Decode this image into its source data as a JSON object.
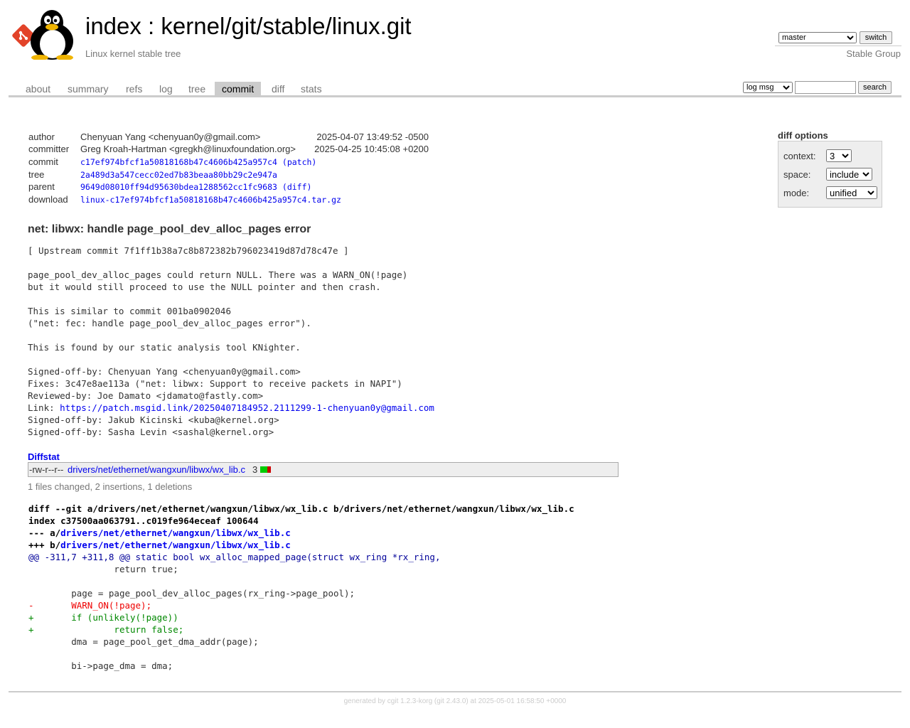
{
  "header": {
    "title_index": "index",
    "title_sep": " : ",
    "title_repo": "kernel/git/stable/linux.git",
    "subtitle": "Linux kernel stable tree",
    "owner": "Stable Group",
    "branch_selected": "master",
    "switch_label": "switch"
  },
  "tabs": [
    {
      "label": "about"
    },
    {
      "label": "summary"
    },
    {
      "label": "refs"
    },
    {
      "label": "log"
    },
    {
      "label": "tree"
    },
    {
      "label": "commit",
      "active": true
    },
    {
      "label": "diff"
    },
    {
      "label": "stats"
    }
  ],
  "search": {
    "mode_selected": "log msg",
    "query": "",
    "button_label": "search"
  },
  "diff_options": {
    "title": "diff options",
    "context_label": "context:",
    "context_value": "3",
    "space_label": "space:",
    "space_value": "include",
    "mode_label": "mode:",
    "mode_value": "unified"
  },
  "commit_info": {
    "author_label": "author",
    "author": "Chenyuan Yang <chenyuan0y@gmail.com>",
    "author_date": "2025-04-07 13:49:52 -0500",
    "committer_label": "committer",
    "committer": "Greg Kroah-Hartman <gregkh@linuxfoundation.org>",
    "committer_date": "2025-04-25 10:45:08 +0200",
    "commit_label": "commit",
    "commit": "c17ef974bfcf1a50818168b47c4606b425a957c4",
    "commit_link": "(patch)",
    "tree_label": "tree",
    "tree": "2a489d3a547cecc02ed7b83beaa80bb29c2e947a",
    "parent_label": "parent",
    "parent": "9649d08010ff94d95630bdea1288562cc1fc9683",
    "parent_link": "(diff)",
    "download_label": "download",
    "download": "linux-c17ef974bfcf1a50818168b47c4606b425a957c4.tar.gz"
  },
  "commit_subject": "net: libwx: handle page_pool_dev_alloc_pages error",
  "commit_message": {
    "before_link": "[ Upstream commit 7f1ff1b38a7c8b872382b796023419d87d78c47e ]\n\npage_pool_dev_alloc_pages could return NULL. There was a WARN_ON(!page)\nbut it would still proceed to use the NULL pointer and then crash.\n\nThis is similar to commit 001ba0902046\n(\"net: fec: handle page_pool_dev_alloc_pages error\").\n\nThis is found by our static analysis tool KNighter.\n\nSigned-off-by: Chenyuan Yang <chenyuan0y@gmail.com>\nFixes: 3c47e8ae113a (\"net: libwx: Support to receive packets in NAPI\")\nReviewed-by: Joe Damato <jdamato@fastly.com>\nLink: ",
    "link": "https://patch.msgid.link/20250407184952.2111299-1-chenyuan0y@gmail.com",
    "after_link": "\nSigned-off-by: Jakub Kicinski <kuba@kernel.org>\nSigned-off-by: Sasha Levin <sashal@kernel.org>"
  },
  "diffstat": {
    "header": "Diffstat",
    "mode": "-rw-r--r--",
    "file": "drivers/net/ethernet/wangxun/libwx/wx_lib.c",
    "count": "3",
    "insertions": 2,
    "deletions": 1,
    "add_color": "#0c0",
    "del_color": "#c00",
    "summary": "1 files changed, 2 insertions, 1 deletions"
  },
  "diff": {
    "header1": "diff --git a/drivers/net/ethernet/wangxun/libwx/wx_lib.c b/drivers/net/ethernet/wangxun/libwx/wx_lib.c",
    "header2": "index c37500aa063791..c019fe964eceaf 100644",
    "old_prefix": "--- a/",
    "old_file": "drivers/net/ethernet/wangxun/libwx/wx_lib.c",
    "new_prefix": "+++ b/",
    "new_file": "drivers/net/ethernet/wangxun/libwx/wx_lib.c",
    "hunk_range": "@@ -311,7 +311,8 @@",
    "hunk_context": " static bool wx_alloc_mapped_page(struct wx_ring *rx_ring,",
    "lines": [
      {
        "type": "ctx",
        "text": " \t\treturn true;"
      },
      {
        "type": "ctx",
        "text": " "
      },
      {
        "type": "ctx",
        "text": " \tpage = page_pool_dev_alloc_pages(rx_ring->page_pool);"
      },
      {
        "type": "del",
        "text": "-\tWARN_ON(!page);"
      },
      {
        "type": "add",
        "text": "+\tif (unlikely(!page))"
      },
      {
        "type": "add",
        "text": "+\t\treturn false;"
      },
      {
        "type": "ctx",
        "text": " \tdma = page_pool_get_dma_addr(page);"
      },
      {
        "type": "ctx",
        "text": " "
      },
      {
        "type": "ctx",
        "text": " \tbi->page_dma = dma;"
      }
    ]
  },
  "footer": "generated by cgit 1.2.3-korg (git 2.43.0) at 2025-05-01 16:58:50 +0000"
}
